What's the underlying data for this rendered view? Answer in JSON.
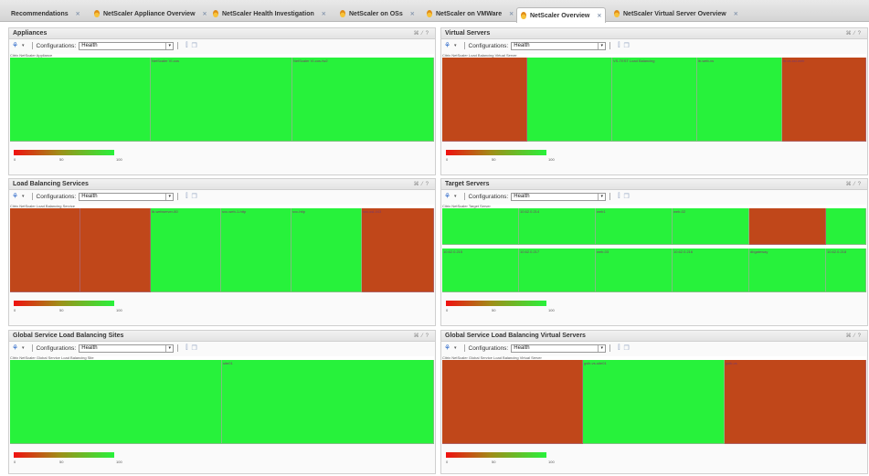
{
  "tabs": [
    {
      "label": "Recommendations",
      "icon": "none",
      "active": false
    },
    {
      "label": "NetScaler Appliance Overview",
      "icon": "flame-icon",
      "active": false
    },
    {
      "label": "NetScaler Health Investigation",
      "icon": "flame-icon",
      "active": false
    },
    {
      "label": "NetScaler on OSs",
      "icon": "flame-icon",
      "active": false
    },
    {
      "label": "NetScaler on VMWare",
      "icon": "flame-icon",
      "active": false
    },
    {
      "label": "NetScaler Overview",
      "icon": "flame-icon",
      "active": true
    },
    {
      "label": "NetScaler Virtual Server Overview",
      "icon": "flame-icon",
      "active": false
    }
  ],
  "common": {
    "config_label": "Configurations:",
    "config_value": "Health",
    "legend_ticks": [
      "0",
      "50",
      "100"
    ]
  },
  "colors": {
    "healthy": "#27f23b",
    "critical": "#c0471a",
    "legend_low": "#f01010",
    "legend_high": "#27f23b"
  },
  "panels": [
    {
      "title": "Appliances",
      "caption": "Citrix NetScaler Appliance",
      "tiles": [
        {
          "label": "",
          "status": "healthy"
        },
        {
          "label": "NetScaler VI-cos",
          "status": "healthy"
        },
        {
          "label": "NetScaler VI-cos-fw2",
          "status": "healthy"
        }
      ]
    },
    {
      "title": "Virtual Servers",
      "caption": "Citrix NetScaler Load Balancing Virtual Server",
      "tiles": [
        {
          "label": "",
          "status": "critical"
        },
        {
          "label": "",
          "status": "healthy"
        },
        {
          "label": "VS-TEST Load Balancing",
          "status": "healthy"
        },
        {
          "label": "lb-web-vs",
          "status": "healthy"
        },
        {
          "label": "lb-vs-ssl-web",
          "status": "critical"
        }
      ]
    },
    {
      "title": "Load Balancing Services",
      "caption": "Citrix NetScaler Load Balancing Service",
      "tiles": [
        {
          "label": "",
          "status": "critical"
        },
        {
          "label": "",
          "status": "critical"
        },
        {
          "label": "lb-webserver-80",
          "status": "healthy"
        },
        {
          "label": "svc-web-1-http",
          "status": "healthy"
        },
        {
          "label": "svc-http",
          "status": "healthy"
        },
        {
          "label": "svc-ssl-443",
          "status": "critical"
        }
      ]
    },
    {
      "title": "Target Servers",
      "caption": "Citrix NetScaler Target Server",
      "tiles": [
        {
          "label": "",
          "status": "healthy"
        },
        {
          "label": "10.62.0.214",
          "status": "healthy"
        },
        {
          "label": "web1",
          "status": "healthy"
        },
        {
          "label": "web-02",
          "status": "healthy"
        },
        {
          "label": "",
          "status": "critical"
        },
        {
          "label": "10.62.0.215",
          "status": "healthy"
        },
        {
          "label": "10.62.0.217",
          "status": "healthy"
        },
        {
          "label": "web-03",
          "status": "healthy"
        },
        {
          "label": "10.62.0.216",
          "status": "healthy"
        },
        {
          "label": "dbgateway",
          "status": "healthy"
        },
        {
          "label": "10.62.0.218",
          "status": "healthy"
        },
        {
          "label": "",
          "status": "healthy"
        }
      ]
    },
    {
      "title": "Global Service Load Balancing Sites",
      "caption": "Citrix NetScaler Global Service Load Balancing Site",
      "tiles": [
        {
          "label": "",
          "status": "healthy"
        },
        {
          "label": "site01",
          "status": "healthy"
        }
      ]
    },
    {
      "title": "Global Service Load Balancing Virtual Servers",
      "caption": "Citrix NetScaler Global Service Load Balancing Virtual Server",
      "tiles": [
        {
          "label": "",
          "status": "critical"
        },
        {
          "label": "gslb-vs-site01",
          "status": "healthy"
        },
        {
          "label": "gslb-vs",
          "status": "critical"
        }
      ]
    }
  ]
}
